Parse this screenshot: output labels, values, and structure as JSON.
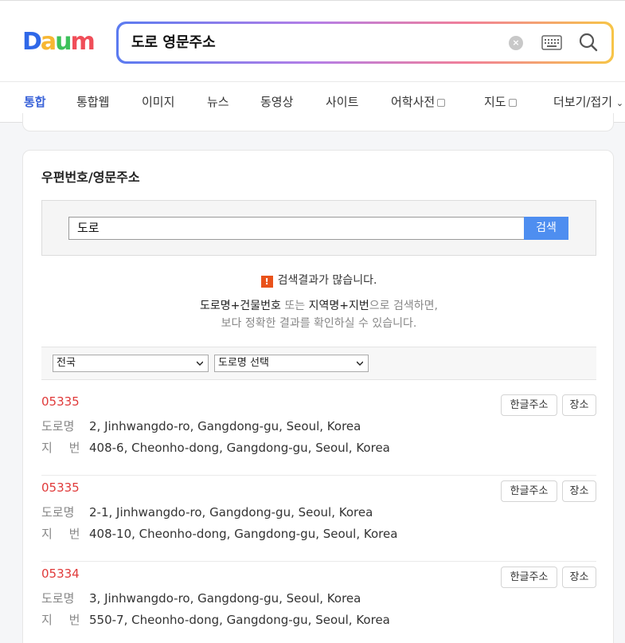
{
  "header": {
    "logo": "Daum",
    "search_query": "도로 영문주소",
    "colors": {
      "accent": "#3a63d8",
      "zip": "#e03a3a",
      "button": "#4e8ef0"
    }
  },
  "tabs": [
    {
      "label": "통합",
      "active": true
    },
    {
      "label": "통합웹"
    },
    {
      "label": "이미지"
    },
    {
      "label": "뉴스"
    },
    {
      "label": "동영상"
    },
    {
      "label": "사이트"
    },
    {
      "label": "어학사전"
    },
    {
      "label": "지도"
    },
    {
      "label": "더보기/접기"
    }
  ],
  "card": {
    "title": "우편번호/영문주소",
    "search_value": "도로",
    "search_button": "검색",
    "notice": "검색결과가 많습니다.",
    "hint_bold1": "도로명+건물번호",
    "hint_mid": " 또는 ",
    "hint_bold2": "지역명+지번",
    "hint_tail": "으로 검색하면,",
    "hint_line2": "보다 정확한 결과를 확인하실 수 있습니다.",
    "region_select": "전국",
    "road_select": "도로명 선택"
  },
  "labels": {
    "road": "도로명",
    "lot": "지  번",
    "korean_btn": "한글주소",
    "place_btn": "장소"
  },
  "results": [
    {
      "zip": "05335",
      "road": "2, Jinhwangdo-ro, Gangdong-gu, Seoul, Korea",
      "lot": "408-6, Cheonho-dong, Gangdong-gu, Seoul, Korea"
    },
    {
      "zip": "05335",
      "road": "2-1, Jinhwangdo-ro, Gangdong-gu, Seoul, Korea",
      "lot": "408-10, Cheonho-dong, Gangdong-gu, Seoul, Korea"
    },
    {
      "zip": "05334",
      "road": "3, Jinhwangdo-ro, Gangdong-gu, Seoul, Korea",
      "lot": "550-7, Cheonho-dong, Gangdong-gu, Seoul, Korea"
    }
  ]
}
